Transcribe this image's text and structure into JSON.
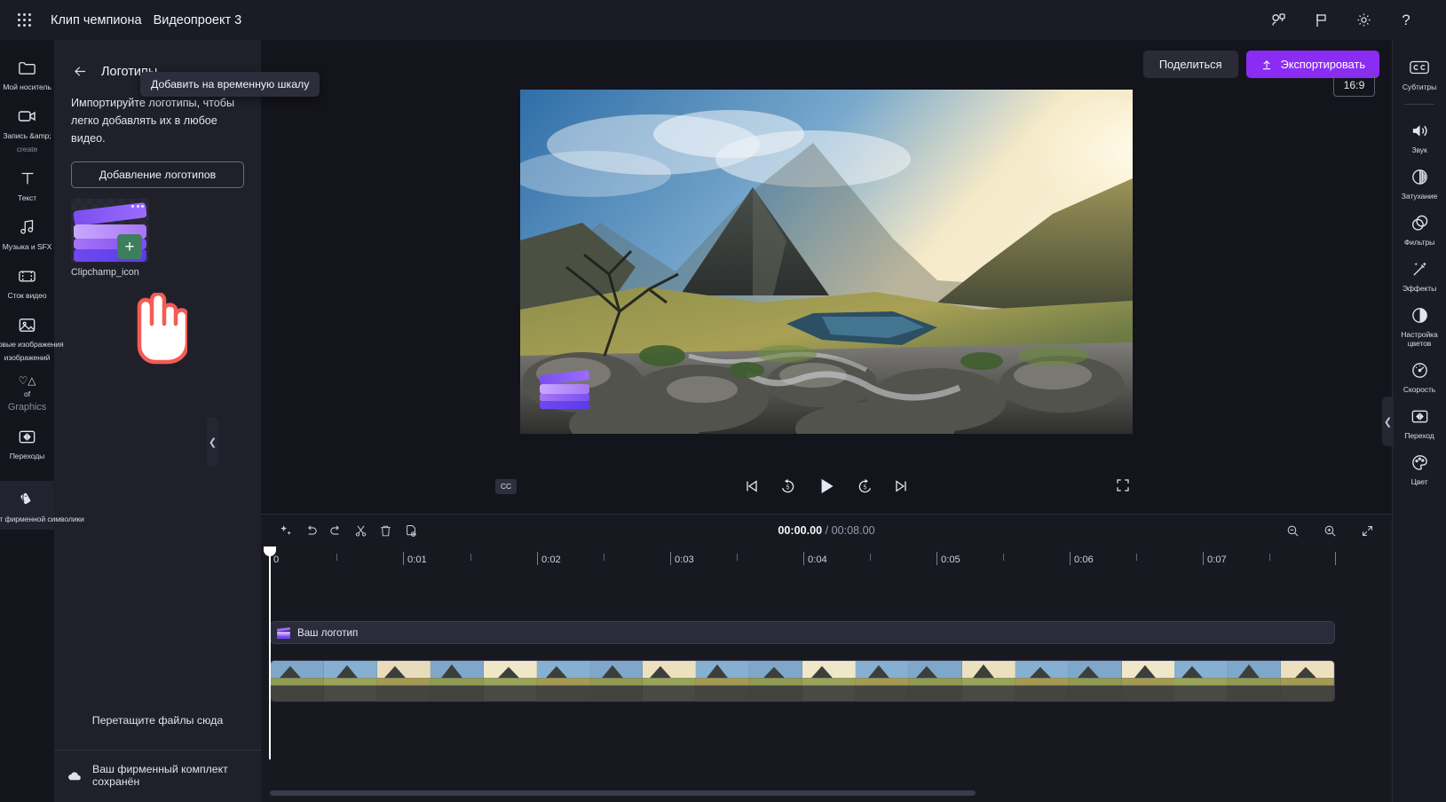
{
  "titlebar": {
    "app_title": "Клип чемпиона",
    "project_title": "Видеопроект 3",
    "icons": {
      "waffle": "app-launcher-icon",
      "collab": "collaborate-icon",
      "flag": "feedback-flag-icon",
      "settings": "gear-icon",
      "help": "?"
    }
  },
  "left_rail": {
    "items": [
      {
        "label": "Мой носитель",
        "icon": "folder-icon",
        "dim": false,
        "active": false
      },
      {
        "label": "Запись &amp;",
        "label2": "create",
        "icon": "record-camera-icon",
        "dim": true,
        "active": false
      },
      {
        "label": "Текст",
        "icon": "text-t-icon",
        "dim": false,
        "active": false
      },
      {
        "label": "Музыка и SFX",
        "icon": "music-note-icon",
        "dim": false,
        "active": false
      },
      {
        "label": "Сток видео",
        "icon": "film-strip-icon",
        "dim": false,
        "active": false
      },
      {
        "label": "оковые изображения",
        "label2": "изображений",
        "icon": "image-icon",
        "dim": false,
        "active": false
      },
      {
        "label": "♡△",
        "label2": "of",
        "label3": "Graphics",
        "icon": "graphics-icon",
        "dim": true,
        "active": false
      },
      {
        "label": "Переходы",
        "icon": "transition-icon",
        "dim": false,
        "active": false
      },
      {
        "label": "Комплект фирменной символики",
        "icon": "brand-kit-icon",
        "dim": false,
        "active": true
      }
    ]
  },
  "panel": {
    "back_icon": "back-arrow-icon",
    "title": "Логотипы",
    "description": "Импортируйте логотипы, чтобы легко добавлять их в любое видео.",
    "add_button": "Добавление логотипов",
    "asset": {
      "name": "Clipchamp_icon",
      "plus": "+",
      "tooltip": "Добавить на временную шкалу"
    },
    "drop_hint": "Перетащите файлы сюда",
    "footer": {
      "icon": "cloud-saved-icon",
      "text": "Ваш фирменный комплект сохранён"
    }
  },
  "actions": {
    "share": "Поделиться",
    "export": "Экспортировать",
    "export_icon": "upload-arrow-icon"
  },
  "preview": {
    "aspect_ratio": "16:9",
    "cc_label": "CC",
    "controls": {
      "prev": "skip-previous-icon",
      "back5": "rewind-5-icon",
      "play": "play-icon",
      "fwd5": "forward-5-icon",
      "next": "skip-next-icon",
      "fullscreen": "fullscreen-icon"
    }
  },
  "timeline": {
    "tools": [
      {
        "name": "magic-wand-icon",
        "label": "sparkle"
      },
      {
        "name": "undo-icon",
        "label": "undo"
      },
      {
        "name": "redo-icon",
        "label": "redo"
      },
      {
        "name": "split-scissors-icon",
        "label": "split"
      },
      {
        "name": "delete-trash-icon",
        "label": "delete"
      },
      {
        "name": "duplicate-icon",
        "label": "duplicate"
      }
    ],
    "current_time": "00:00.00",
    "total_time": "/ 00:08.00",
    "zoom_tools": [
      {
        "name": "zoom-out-icon"
      },
      {
        "name": "zoom-in-icon"
      },
      {
        "name": "fit-timeline-icon"
      }
    ],
    "ruler_labels": [
      "0",
      "0:01",
      "0:02",
      "0:03",
      "0:04",
      "0:05",
      "0:06",
      "0:07"
    ],
    "tracks": [
      {
        "type": "logo",
        "label": "Ваш логотип",
        "icon": "logo-clip-icon"
      },
      {
        "type": "video",
        "label": ""
      }
    ],
    "collapse_icon": "chevron-down-icon"
  },
  "right_rail": {
    "items": [
      {
        "label": "Субтитры",
        "icon": "closed-caption-icon",
        "divider_after": true
      },
      {
        "label": "Звук",
        "icon": "speaker-icon"
      },
      {
        "label": "Затухание",
        "icon": "fade-icon"
      },
      {
        "label": "Фильтры",
        "icon": "filters-icon"
      },
      {
        "label": "Эффекты",
        "icon": "effects-wand-icon"
      },
      {
        "label": "Настройка цветов",
        "icon": "color-adjust-icon"
      },
      {
        "label": "Скорость",
        "icon": "speed-gauge-icon"
      },
      {
        "label": "Переход",
        "icon": "transition-icon"
      },
      {
        "label": "Цвет",
        "icon": "color-palette-icon"
      }
    ],
    "collapse_icon": "chevron-left-icon"
  },
  "colors": {
    "accent": "#8b2cf5",
    "panel_bg": "#20202b",
    "app_bg": "#14141c",
    "logo_purple": "#7b4ff0"
  }
}
